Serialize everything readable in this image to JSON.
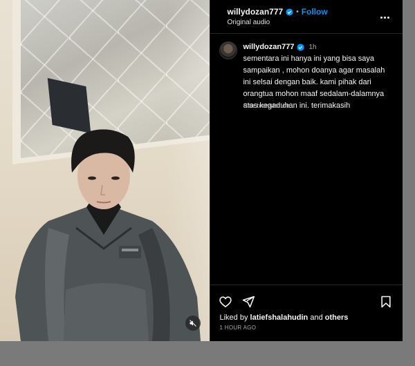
{
  "header": {
    "username": "willydozan777",
    "follow_label": "Follow",
    "dot": "•",
    "audio": "Original audio"
  },
  "caption": {
    "username": "willydozan777",
    "time": "1h",
    "text": "sementara ini hanya ini yang bisa saya\nsampaikan , mohon doanya agar masalah\nini selsai dengan baik. kami pihak dari\norangtua mohon maaf sedalam-dalamnya\natas kegaduhan ini. terimakasih",
    "see_translation": "See translation"
  },
  "footer": {
    "liked_prefix": "Liked by",
    "liked_user": "latiefshalahudin",
    "liked_and": "and",
    "liked_others": "others",
    "time_ago": "1 HOUR AGO"
  },
  "icons": {
    "verified": "verified-badge-icon",
    "more": "more-options-icon",
    "like": "heart-icon",
    "share": "share-icon",
    "save": "bookmark-icon",
    "mute": "volume-muted-icon"
  },
  "colors": {
    "accent": "#0095f6",
    "background": "#000000",
    "secondary_text": "#a8a8a8"
  }
}
